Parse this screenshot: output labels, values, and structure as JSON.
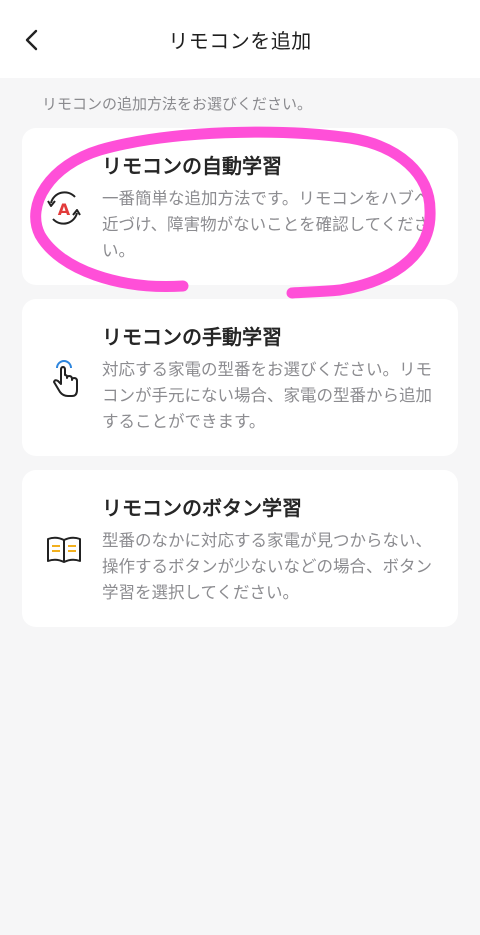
{
  "header": {
    "back_icon": "chevron-left-icon",
    "title": "リモコンを追加"
  },
  "subtitle": "リモコンの追加方法をお選びください。",
  "cards": [
    {
      "icon": "auto-learn-icon",
      "title": "リモコンの自動学習",
      "description": "一番簡単な追加方法です。リモコンをハブへ近づけ、障害物がないことを確認してください。"
    },
    {
      "icon": "tap-finger-icon",
      "title": "リモコンの手動学習",
      "description": "対応する家電の型番をお選びください。リモコンが手元にない場合、家電の型番から追加することができます。"
    },
    {
      "icon": "book-icon",
      "title": "リモコンのボタン学習",
      "description": "型番のなかに対応する家電が見つからない、操作するボタンが少ないなどの場合、ボタン学習を選択してください。"
    }
  ],
  "colors": {
    "annotation": "#ff4fd8",
    "accent_red": "#e23b3b",
    "accent_blue": "#2e86de",
    "accent_yellow": "#f2b01e"
  }
}
